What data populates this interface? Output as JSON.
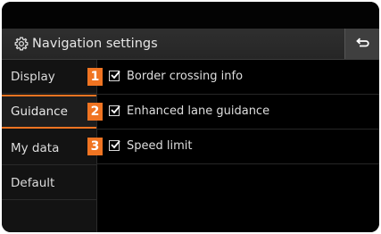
{
  "header": {
    "title": "Navigation settings",
    "settings_icon": "gear-icon",
    "back_icon": "return-arrow-icon"
  },
  "sidebar": {
    "items": [
      {
        "label": "Display",
        "active": false
      },
      {
        "label": "Guidance",
        "active": true
      },
      {
        "label": "My data",
        "active": false
      },
      {
        "label": "Default",
        "active": false
      }
    ]
  },
  "options": [
    {
      "number": "1",
      "label": "Border crossing info",
      "checked": true
    },
    {
      "number": "2",
      "label": "Enhanced lane guidance",
      "checked": true
    },
    {
      "number": "3",
      "label": "Speed limit",
      "checked": true
    }
  ],
  "colors": {
    "accent": "#f07422",
    "background": "#000000",
    "text": "#dedede"
  }
}
